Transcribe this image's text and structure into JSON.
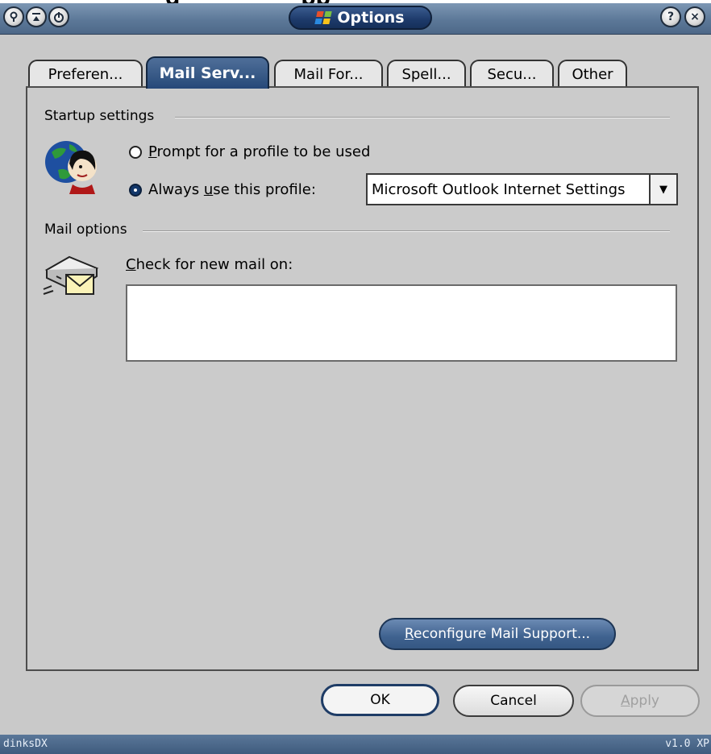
{
  "background_heading": {
    "part1": "g",
    "part2": "pp"
  },
  "window": {
    "title": "Options",
    "buttons": {
      "help": "?",
      "close": "×"
    }
  },
  "tabs": [
    {
      "label": "Preferen...",
      "active": false
    },
    {
      "label": "Mail Serv...",
      "active": true
    },
    {
      "label": "Mail For...",
      "active": false
    },
    {
      "label": "Spell...",
      "active": false
    },
    {
      "label": "Secu...",
      "active": false
    },
    {
      "label": "Other",
      "active": false
    }
  ],
  "startup": {
    "group_label": "Startup settings",
    "option_prompt": {
      "mnemonic": "P",
      "rest": "rompt for a profile to be used",
      "selected": false
    },
    "option_always": {
      "before": "Always ",
      "mnemonic": "u",
      "after": "se this profile:",
      "selected": true
    },
    "profile_select": {
      "value": "Microsoft Outlook Internet Settings",
      "arrow": "▼"
    }
  },
  "mail_options": {
    "group_label": "Mail options",
    "check_label": {
      "mnemonic": "C",
      "rest": "heck for new mail on:"
    },
    "accounts": []
  },
  "reconfigure_button": {
    "mnemonic": "R",
    "rest": "econfigure Mail Support..."
  },
  "dialog_buttons": {
    "ok": "OK",
    "cancel": "Cancel",
    "apply": {
      "mnemonic": "A",
      "rest": "pply",
      "enabled": false
    }
  },
  "statusbar": {
    "left": "dinksDX",
    "right": "v1.0 XP"
  },
  "colors": {
    "title_pill": "#1d3a6a",
    "active_tab": "#264878",
    "panel": "#cbcbcb"
  }
}
